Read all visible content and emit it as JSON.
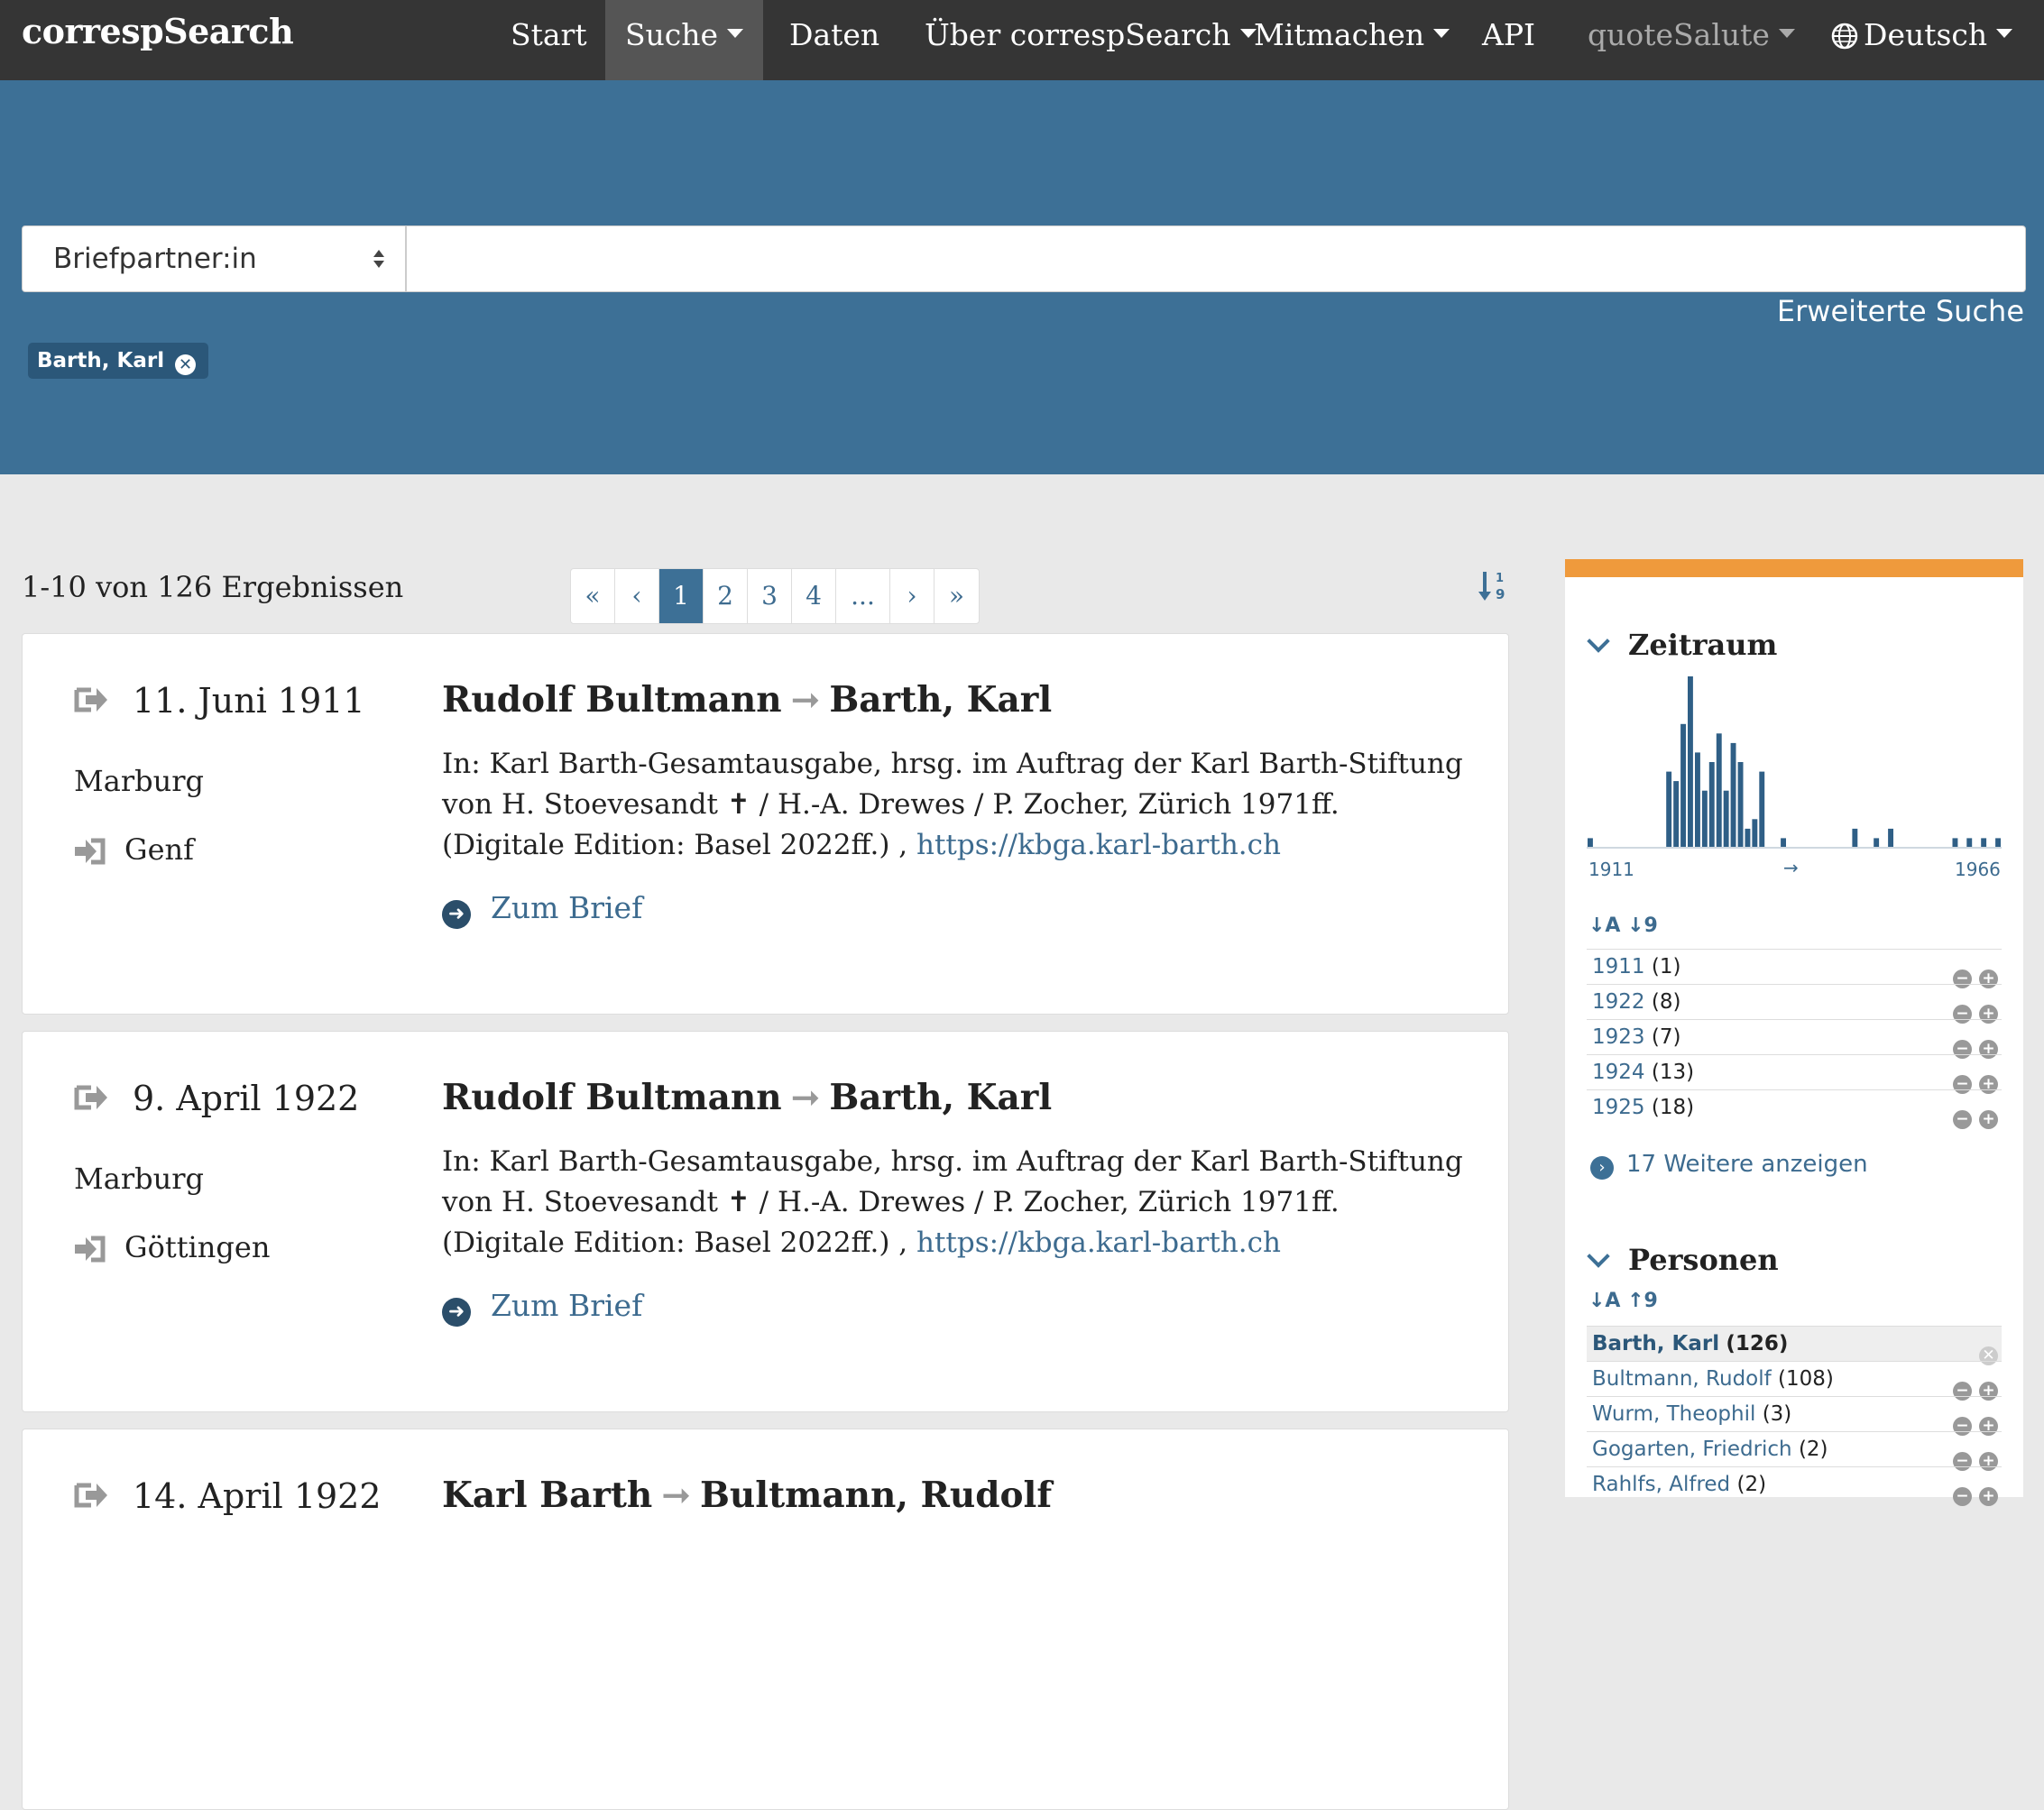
{
  "navbar": {
    "brand": "correspSearch",
    "items": [
      {
        "label": "Start"
      },
      {
        "label": "Suche"
      },
      {
        "label": "Daten"
      },
      {
        "label": "Über correspSearch"
      },
      {
        "label": "Mitmachen"
      },
      {
        "label": "API"
      },
      {
        "label": "quoteSalute"
      },
      {
        "label": "Deutsch"
      }
    ]
  },
  "search": {
    "field": "Briefpartner:in",
    "query": "",
    "advanced": "Erweiterte Suche",
    "active_filter": "Barth, Karl"
  },
  "results": {
    "count_text": "1-10 von 126 Ergebnissen",
    "pagination": [
      "«",
      "‹",
      "1",
      "2",
      "3",
      "4",
      "...",
      "›",
      "»"
    ],
    "items": [
      {
        "date": "11. Juni 1911",
        "place_from": "Marburg",
        "place_to": "Genf",
        "sender": "Rudolf Bultmann",
        "arrow": "➞",
        "receiver": "Barth, Karl",
        "source": "In: Karl Barth-Gesamtausgabe, hrsg. im Auftrag der Karl Barth-Stiftung von H. Stoevesandt ✝ / H.-A. Drewes / P. Zocher, Zürich 1971ff. (Digitale Edition: Basel 2022ff.) ,",
        "url": "https://kbga.karl-barth.ch",
        "link": "Zum Brief"
      },
      {
        "date": "9. April 1922",
        "place_from": "Marburg",
        "place_to": "Göttingen",
        "sender": "Rudolf Bultmann",
        "arrow": "➞",
        "receiver": "Barth, Karl",
        "source": "In: Karl Barth-Gesamtausgabe, hrsg. im Auftrag der Karl Barth-Stiftung von H. Stoevesandt ✝ / H.-A. Drewes / P. Zocher, Zürich 1971ff. (Digitale Edition: Basel 2022ff.) ,",
        "url": "https://kbga.karl-barth.ch",
        "link": "Zum Brief"
      },
      {
        "date": "14. April 1922",
        "sender": "Karl Barth",
        "arrow": "➞",
        "receiver": "Bultmann, Rudolf"
      }
    ]
  },
  "sidebar": {
    "accent": "#ef9a3c",
    "zeitraum": {
      "title": "Zeitraum",
      "hist_start": "1911",
      "hist_end": "1966",
      "hist_arrow": "→",
      "sort_icons": "↓A ↓9",
      "rows": [
        {
          "label": "1911",
          "count": "(1)"
        },
        {
          "label": "1922",
          "count": "(8)"
        },
        {
          "label": "1923",
          "count": "(7)"
        },
        {
          "label": "1924",
          "count": "(13)"
        },
        {
          "label": "1925",
          "count": "(18)"
        }
      ],
      "more": "17 Weitere anzeigen"
    },
    "personen": {
      "title": "Personen",
      "sort_icons": "↓A ↑9",
      "rows": [
        {
          "label": "Barth, Karl",
          "count": "(126)"
        },
        {
          "label": "Bultmann, Rudolf",
          "count": "(108)"
        },
        {
          "label": "Wurm, Theophil",
          "count": "(3)"
        },
        {
          "label": "Gogarten, Friedrich",
          "count": "(2)"
        },
        {
          "label": "Rahlfs, Alfred",
          "count": "(2)"
        }
      ]
    },
    "histogram": [
      1,
      0,
      0,
      0,
      0,
      0,
      0,
      0,
      0,
      0,
      0,
      8,
      7,
      13,
      18,
      10,
      6,
      9,
      12,
      6,
      11,
      9,
      2,
      3,
      8,
      0,
      0,
      1,
      0,
      0,
      0,
      0,
      0,
      0,
      0,
      0,
      0,
      2,
      0,
      0,
      1,
      0,
      2,
      0,
      0,
      0,
      0,
      0,
      0,
      0,
      0,
      1,
      0,
      1,
      0,
      1,
      0,
      1
    ]
  }
}
